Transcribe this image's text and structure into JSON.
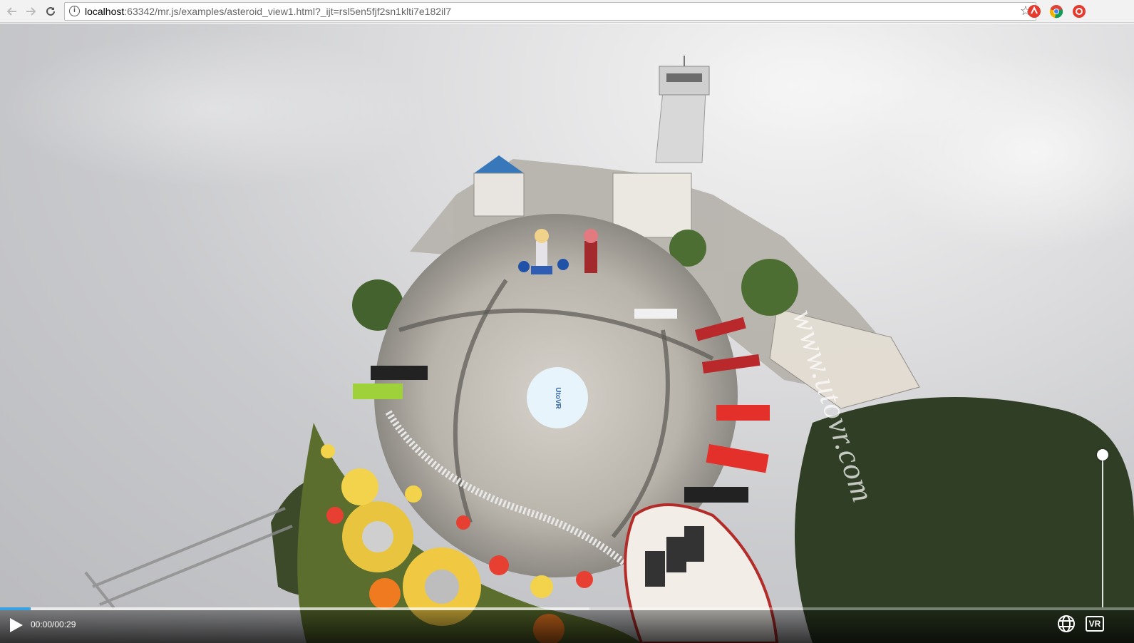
{
  "browser": {
    "url_host": "localhost",
    "url_rest": ":63342/mr.js/examples/asteroid_view1.html?_ijt=rsl5en5fjf2sn1klti7e182il7",
    "icons": [
      "back-icon",
      "forward-icon",
      "reload-icon",
      "info-icon",
      "star-icon"
    ],
    "extensions": [
      "extension-red-icon",
      "chrome-icon",
      "extension-red-circle-icon"
    ]
  },
  "video": {
    "watermark": "www.utovr.com",
    "logo_text": "UtoVR",
    "current_time": "00:00/00:29",
    "progress_fraction": 0.027,
    "buffer_fraction": 0.52,
    "vr_label": "VR",
    "icons": [
      "play-icon",
      "globe-icon"
    ]
  },
  "colors": {
    "accent": "#35a2e6",
    "sky": "#c9cacd",
    "plaza": "#bdb8b0"
  }
}
